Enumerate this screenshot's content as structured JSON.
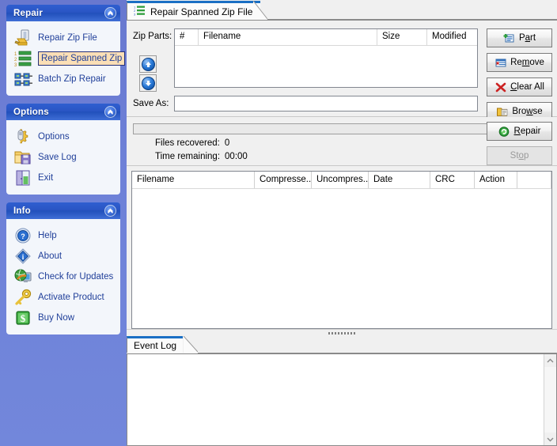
{
  "sidebar": {
    "panels": [
      {
        "title": "Repair",
        "collapse_icon": "chevron-up-circle-icon",
        "items": [
          {
            "label": "Repair Zip File",
            "icon": "repair-zip-file-icon",
            "selected": false
          },
          {
            "label": "Repair Spanned Zip",
            "icon": "repair-spanned-zip-icon",
            "selected": true
          },
          {
            "label": "Batch Zip Repair",
            "icon": "batch-zip-repair-icon",
            "selected": false
          }
        ]
      },
      {
        "title": "Options",
        "collapse_icon": "chevron-up-circle-icon",
        "items": [
          {
            "label": "Options",
            "icon": "gear-icon",
            "selected": false
          },
          {
            "label": "Save Log",
            "icon": "save-floppy-folder-icon",
            "selected": false
          },
          {
            "label": "Exit",
            "icon": "exit-door-icon",
            "selected": false
          }
        ]
      },
      {
        "title": "Info",
        "collapse_icon": "chevron-up-circle-icon",
        "items": [
          {
            "label": "Help",
            "icon": "help-question-icon",
            "selected": false
          },
          {
            "label": "About",
            "icon": "info-icon",
            "selected": false
          },
          {
            "label": "Check for Updates",
            "icon": "globe-monitor-icon",
            "selected": false
          },
          {
            "label": "Activate Product",
            "icon": "key-icon",
            "selected": false
          },
          {
            "label": "Buy Now",
            "icon": "dollar-icon",
            "selected": false
          }
        ]
      }
    ]
  },
  "main": {
    "tab": {
      "label": "Repair Spanned Zip File",
      "icon": "ordered-list-icon"
    },
    "zip_parts": {
      "label": "Zip Parts:",
      "columns": [
        "#",
        "Filename",
        "Size",
        "Modified"
      ],
      "rows": [],
      "move_up_icon": "arrow-up-circle-icon",
      "move_down_icon": "arrow-down-circle-icon"
    },
    "save_as": {
      "label": "Save As:",
      "value": "",
      "placeholder": ""
    },
    "buttons": [
      {
        "name": "part",
        "pre": "P",
        "acc": "a",
        "post": "rt",
        "icon": "add-part-icon",
        "disabled": false
      },
      {
        "name": "remove",
        "pre": "Re",
        "acc": "m",
        "post": "ove",
        "icon": "remove-row-icon",
        "disabled": false
      },
      {
        "name": "clear-all",
        "pre": "",
        "acc": "C",
        "post": "lear All",
        "icon": "red-x-icon",
        "disabled": false
      },
      {
        "name": "browse",
        "pre": "Bro",
        "acc": "w",
        "post": "se",
        "icon": "folder-browse-icon",
        "disabled": false
      },
      {
        "name": "repair",
        "pre": "",
        "acc": "R",
        "post": "epair",
        "icon": "green-repair-icon",
        "disabled": false
      },
      {
        "name": "stop",
        "pre": "St",
        "acc": "o",
        "post": "p",
        "icon": "",
        "disabled": true
      }
    ],
    "progress": {
      "percent": 0,
      "files_recovered_label": "Files recovered:",
      "files_recovered_value": "0",
      "time_remaining_label": "Time remaining:",
      "time_remaining_value": "00:00"
    },
    "results": {
      "columns": [
        "Filename",
        "Compresse...",
        "Uncompres...",
        "Date",
        "CRC",
        "Action"
      ],
      "rows": []
    },
    "event_log": {
      "tab_label": "Event Log",
      "content": "",
      "scroll_up_icon": "scroll-up-arrow-icon",
      "scroll_down_icon": "scroll-down-arrow-icon"
    },
    "splitter_icon": "splitter-grip-icon"
  },
  "colors": {
    "sidebar_bg": "#6e81d8",
    "panel_header_start": "#2f5fd0",
    "panel_header_end": "#3f6ed6",
    "link_text": "#21409a",
    "selected_bg": "#fbdfb6",
    "selected_border": "#24307a",
    "tab_accent": "#1a6fc4"
  }
}
